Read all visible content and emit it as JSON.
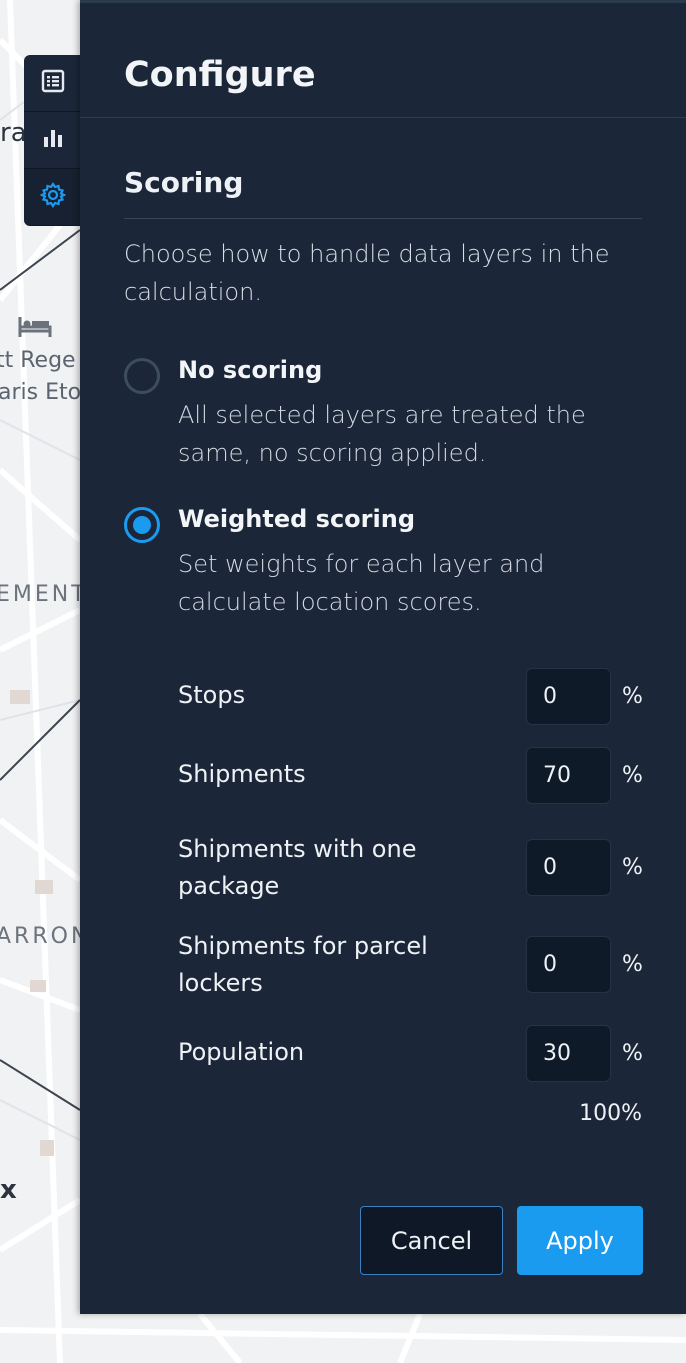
{
  "map": {
    "labels": [
      "ra",
      "tt Rege",
      "aris Etoi",
      "EMENT",
      "ARRON",
      "x"
    ]
  },
  "rail": {
    "items": [
      {
        "name": "list",
        "icon": "list-icon"
      },
      {
        "name": "chart",
        "icon": "bar-chart-icon"
      },
      {
        "name": "settings",
        "icon": "gear-icon",
        "active": true
      }
    ]
  },
  "panel": {
    "title": "Configure",
    "section_title": "Scoring",
    "description": "Choose how to handle data layers in the calculation.",
    "options": [
      {
        "label": "No scoring",
        "description": "All selected layers are treated the same, no scoring applied.",
        "selected": false
      },
      {
        "label": "Weighted scoring",
        "description": "Set weights for each layer and calculate location scores.",
        "selected": true
      }
    ],
    "weights": [
      {
        "label": "Stops",
        "value": "0",
        "unit": "%"
      },
      {
        "label": "Shipments",
        "value": "70",
        "unit": "%"
      },
      {
        "label": "Shipments with one package",
        "value": "0",
        "unit": "%"
      },
      {
        "label": "Shipments for parcel lockers",
        "value": "0",
        "unit": "%"
      },
      {
        "label": "Population",
        "value": "30",
        "unit": "%"
      }
    ],
    "total": "100%",
    "cancel_label": "Cancel",
    "apply_label": "Apply"
  },
  "colors": {
    "panel_bg": "#1b2738",
    "accent": "#1a9bf0",
    "input_bg": "#0f1a28"
  }
}
